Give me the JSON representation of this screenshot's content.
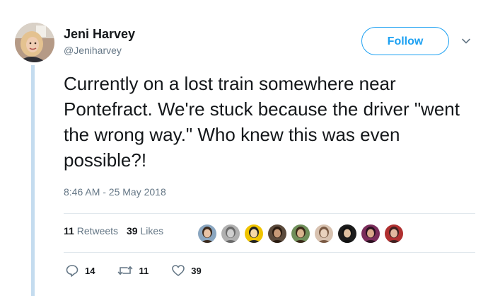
{
  "author": {
    "name": "Jeni Harvey",
    "handle": "@Jeniharvey"
  },
  "follow_button": {
    "label": "Follow"
  },
  "tweet": {
    "text": "Currently on a lost train somewhere near Pontefract. We're stuck because the driver \"went the wrong way.\" Who knew this was even possible?!",
    "timestamp": "8:46 AM - 25 May 2018"
  },
  "stats": {
    "retweets_count": "11",
    "retweets_label": "Retweets",
    "likes_count": "39",
    "likes_label": "Likes"
  },
  "likers": [
    {
      "color": "#8aa6c0",
      "skin": "#e8c3a5",
      "hair": "#3b2a1e"
    },
    {
      "color": "#b0b0b0",
      "skin": "#cfcfcf",
      "hair": "#6a6a6a"
    },
    {
      "color": "#f0c400",
      "skin": "#f6d9a8",
      "hair": "#222222"
    },
    {
      "color": "#5b4a3c",
      "skin": "#c89a78",
      "hair": "#2a1b10"
    },
    {
      "color": "#6f8f5a",
      "skin": "#d8b48e",
      "hair": "#3a2a18"
    },
    {
      "color": "#d8c2b0",
      "skin": "#e9d2be",
      "hair": "#7a5a44"
    },
    {
      "color": "#1c1c1c",
      "skin": "#e0c0a0",
      "hair": "#111111"
    },
    {
      "color": "#7a2c5a",
      "skin": "#d9a88a",
      "hair": "#2b1020"
    },
    {
      "color": "#b03030",
      "skin": "#e3b9a0",
      "hair": "#402020"
    }
  ],
  "actions": {
    "reply_count": "14",
    "retweet_count": "11",
    "like_count": "39"
  },
  "colors": {
    "accent": "#1da1f2",
    "secondary_text": "#657786",
    "thread_line": "#c4dcef"
  }
}
